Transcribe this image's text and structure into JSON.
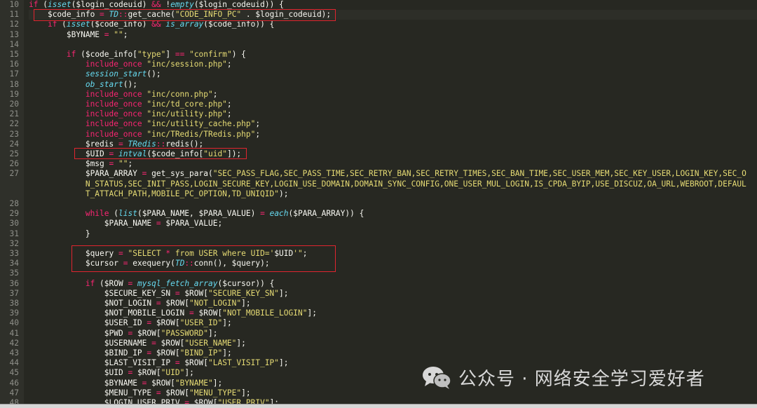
{
  "editor": {
    "theme_colors": {
      "background": "#272822",
      "text": "#f8f8f2",
      "keyword": "#f92672",
      "function": "#66d9ef",
      "string": "#e6db74",
      "highlight": "#e0252f"
    },
    "lines": [
      {
        "n": "10",
        "indent": 0,
        "tokens": [
          [
            "kw",
            "if"
          ],
          [
            "va",
            " ("
          ],
          [
            "fn",
            "isset"
          ],
          [
            "va",
            "($login_codeuid) "
          ],
          [
            "op",
            "&&"
          ],
          [
            "va",
            " !"
          ],
          [
            "fn",
            "empty"
          ],
          [
            "va",
            "($login_codeuid)) {"
          ]
        ]
      },
      {
        "n": "11",
        "indent": 4,
        "tokens": [
          [
            "va",
            "$code_info "
          ],
          [
            "op",
            "="
          ],
          [
            "va",
            " "
          ],
          [
            "cl",
            "TD"
          ],
          [
            "op",
            "::"
          ],
          [
            "va",
            "get_cache("
          ],
          [
            "st",
            "\"CODE_INFO_PC\""
          ],
          [
            "va",
            " . $login_codeuid);"
          ]
        ]
      },
      {
        "n": "12",
        "indent": 4,
        "tokens": [
          [
            "kw",
            "if"
          ],
          [
            "va",
            " ("
          ],
          [
            "fn",
            "isset"
          ],
          [
            "va",
            "($code_info) "
          ],
          [
            "op",
            "&&"
          ],
          [
            "va",
            " "
          ],
          [
            "fn",
            "is_array"
          ],
          [
            "va",
            "($code_info)) {"
          ]
        ]
      },
      {
        "n": "13",
        "indent": 8,
        "tokens": [
          [
            "va",
            "$BYNAME "
          ],
          [
            "op",
            "="
          ],
          [
            "va",
            " "
          ],
          [
            "st",
            "\"\""
          ],
          [
            "va",
            ";"
          ]
        ]
      },
      {
        "n": "14",
        "indent": 0,
        "tokens": []
      },
      {
        "n": "15",
        "indent": 8,
        "tokens": [
          [
            "kw",
            "if"
          ],
          [
            "va",
            " ($code_info["
          ],
          [
            "st",
            "\"type\""
          ],
          [
            "va",
            "] "
          ],
          [
            "op",
            "=="
          ],
          [
            "va",
            " "
          ],
          [
            "st",
            "\"confirm\""
          ],
          [
            "va",
            ") {"
          ]
        ]
      },
      {
        "n": "16",
        "indent": 12,
        "tokens": [
          [
            "kw",
            "include_once"
          ],
          [
            "va",
            " "
          ],
          [
            "st",
            "\"inc/session.php\""
          ],
          [
            "va",
            ";"
          ]
        ]
      },
      {
        "n": "17",
        "indent": 12,
        "tokens": [
          [
            "fn",
            "session_start"
          ],
          [
            "va",
            "();"
          ]
        ]
      },
      {
        "n": "18",
        "indent": 12,
        "tokens": [
          [
            "fn",
            "ob_start"
          ],
          [
            "va",
            "();"
          ]
        ]
      },
      {
        "n": "19",
        "indent": 12,
        "tokens": [
          [
            "kw",
            "include_once"
          ],
          [
            "va",
            " "
          ],
          [
            "st",
            "\"inc/conn.php\""
          ],
          [
            "va",
            ";"
          ]
        ]
      },
      {
        "n": "20",
        "indent": 12,
        "tokens": [
          [
            "kw",
            "include_once"
          ],
          [
            "va",
            " "
          ],
          [
            "st",
            "\"inc/td_core.php\""
          ],
          [
            "va",
            ";"
          ]
        ]
      },
      {
        "n": "21",
        "indent": 12,
        "tokens": [
          [
            "kw",
            "include_once"
          ],
          [
            "va",
            " "
          ],
          [
            "st",
            "\"inc/utility.php\""
          ],
          [
            "va",
            ";"
          ]
        ]
      },
      {
        "n": "22",
        "indent": 12,
        "tokens": [
          [
            "kw",
            "include_once"
          ],
          [
            "va",
            " "
          ],
          [
            "st",
            "\"inc/utility_cache.php\""
          ],
          [
            "va",
            ";"
          ]
        ]
      },
      {
        "n": "23",
        "indent": 12,
        "tokens": [
          [
            "kw",
            "include_once"
          ],
          [
            "va",
            " "
          ],
          [
            "st",
            "\"inc/TRedis/TRedis.php\""
          ],
          [
            "va",
            ";"
          ]
        ]
      },
      {
        "n": "24",
        "indent": 12,
        "tokens": [
          [
            "va",
            "$redis "
          ],
          [
            "op",
            "="
          ],
          [
            "va",
            " "
          ],
          [
            "cl",
            "TRedis"
          ],
          [
            "op",
            "::"
          ],
          [
            "va",
            "redis();"
          ]
        ]
      },
      {
        "n": "25",
        "indent": 12,
        "tokens": [
          [
            "va",
            "$UID "
          ],
          [
            "op",
            "="
          ],
          [
            "va",
            " "
          ],
          [
            "fn",
            "intval"
          ],
          [
            "va",
            "($code_info["
          ],
          [
            "st",
            "\"uid\""
          ],
          [
            "va",
            "]);"
          ]
        ]
      },
      {
        "n": "26",
        "indent": 12,
        "tokens": [
          [
            "va",
            "$msg "
          ],
          [
            "op",
            "="
          ],
          [
            "va",
            " "
          ],
          [
            "st",
            "\"\""
          ],
          [
            "va",
            ";"
          ]
        ]
      },
      {
        "n": "27",
        "indent": 12,
        "tokens": [
          [
            "va",
            "$PARA_ARRAY "
          ],
          [
            "op",
            "="
          ],
          [
            "va",
            " get_sys_para("
          ],
          [
            "st",
            "\"SEC_PASS_FLAG,SEC_PASS_TIME,SEC_RETRY_BAN,SEC_RETRY_TIMES,SEC_BAN_TIME,SEC_USER_MEM,SEC_KEY_USER,LOGIN_KEY,SEC_O"
          ]
        ]
      },
      {
        "n": "",
        "indent": 12,
        "tokens": [
          [
            "st",
            "N_STATUS,SEC_INIT_PASS,LOGIN_SECURE_KEY,LOGIN_USE_DOMAIN,DOMAIN_SYNC_CONFIG,ONE_USER_MUL_LOGIN,IS_CPDA_BYIP,USE_DISCUZ,OA_URL,WEBROOT,DEFAUL"
          ]
        ]
      },
      {
        "n": "",
        "indent": 12,
        "tokens": [
          [
            "st",
            "T_ATTACH_PATH,MOBILE_PC_OPTION,TD_UNIQID\""
          ],
          [
            "va",
            ");"
          ]
        ]
      },
      {
        "n": "28",
        "indent": 0,
        "tokens": []
      },
      {
        "n": "29",
        "indent": 12,
        "tokens": [
          [
            "kw",
            "while"
          ],
          [
            "va",
            " ("
          ],
          [
            "fn",
            "list"
          ],
          [
            "va",
            "($PARA_NAME, $PARA_VALUE) "
          ],
          [
            "op",
            "="
          ],
          [
            "va",
            " "
          ],
          [
            "fn",
            "each"
          ],
          [
            "va",
            "($PARA_ARRAY)) {"
          ]
        ]
      },
      {
        "n": "30",
        "indent": 16,
        "tokens": [
          [
            "va",
            "$PARA_NAME "
          ],
          [
            "op",
            "="
          ],
          [
            "va",
            " $PARA_VALUE;"
          ]
        ]
      },
      {
        "n": "31",
        "indent": 12,
        "tokens": [
          [
            "va",
            "}"
          ]
        ]
      },
      {
        "n": "32",
        "indent": 0,
        "tokens": []
      },
      {
        "n": "33",
        "indent": 12,
        "tokens": [
          [
            "va",
            "$query "
          ],
          [
            "op",
            "="
          ],
          [
            "va",
            " "
          ],
          [
            "st",
            "\"SELECT "
          ],
          [
            "op",
            "*"
          ],
          [
            "st",
            " from USER where UID='"
          ],
          [
            "va",
            "$UID"
          ],
          [
            "st",
            "'\""
          ],
          [
            "va",
            ";"
          ]
        ]
      },
      {
        "n": "34",
        "indent": 12,
        "tokens": [
          [
            "va",
            "$cursor "
          ],
          [
            "op",
            "="
          ],
          [
            "va",
            " exequery("
          ],
          [
            "cl",
            "TD"
          ],
          [
            "op",
            "::"
          ],
          [
            "va",
            "conn(), $query);"
          ]
        ]
      },
      {
        "n": "35",
        "indent": 0,
        "tokens": []
      },
      {
        "n": "36",
        "indent": 12,
        "tokens": [
          [
            "kw",
            "if"
          ],
          [
            "va",
            " ($ROW "
          ],
          [
            "op",
            "="
          ],
          [
            "va",
            " "
          ],
          [
            "fn",
            "mysql_fetch_array"
          ],
          [
            "va",
            "($cursor)) {"
          ]
        ]
      },
      {
        "n": "37",
        "indent": 16,
        "tokens": [
          [
            "va",
            "$SECURE_KEY_SN "
          ],
          [
            "op",
            "="
          ],
          [
            "va",
            " $ROW["
          ],
          [
            "st",
            "\"SECURE_KEY_SN\""
          ],
          [
            "va",
            "];"
          ]
        ]
      },
      {
        "n": "38",
        "indent": 16,
        "tokens": [
          [
            "va",
            "$NOT_LOGIN "
          ],
          [
            "op",
            "="
          ],
          [
            "va",
            " $ROW["
          ],
          [
            "st",
            "\"NOT_LOGIN\""
          ],
          [
            "va",
            "];"
          ]
        ]
      },
      {
        "n": "39",
        "indent": 16,
        "tokens": [
          [
            "va",
            "$NOT_MOBILE_LOGIN "
          ],
          [
            "op",
            "="
          ],
          [
            "va",
            " $ROW["
          ],
          [
            "st",
            "\"NOT_MOBILE_LOGIN\""
          ],
          [
            "va",
            "];"
          ]
        ]
      },
      {
        "n": "40",
        "indent": 16,
        "tokens": [
          [
            "va",
            "$USER_ID "
          ],
          [
            "op",
            "="
          ],
          [
            "va",
            " $ROW["
          ],
          [
            "st",
            "\"USER_ID\""
          ],
          [
            "va",
            "];"
          ]
        ]
      },
      {
        "n": "41",
        "indent": 16,
        "tokens": [
          [
            "va",
            "$PWD "
          ],
          [
            "op",
            "="
          ],
          [
            "va",
            " $ROW["
          ],
          [
            "st",
            "\"PASSWORD\""
          ],
          [
            "va",
            "];"
          ]
        ]
      },
      {
        "n": "42",
        "indent": 16,
        "tokens": [
          [
            "va",
            "$USERNAME "
          ],
          [
            "op",
            "="
          ],
          [
            "va",
            " $ROW["
          ],
          [
            "st",
            "\"USER_NAME\""
          ],
          [
            "va",
            "];"
          ]
        ]
      },
      {
        "n": "43",
        "indent": 16,
        "tokens": [
          [
            "va",
            "$BIND_IP "
          ],
          [
            "op",
            "="
          ],
          [
            "va",
            " $ROW["
          ],
          [
            "st",
            "\"BIND_IP\""
          ],
          [
            "va",
            "];"
          ]
        ]
      },
      {
        "n": "44",
        "indent": 16,
        "tokens": [
          [
            "va",
            "$LAST_VISIT_IP "
          ],
          [
            "op",
            "="
          ],
          [
            "va",
            " $ROW["
          ],
          [
            "st",
            "\"LAST_VISIT_IP\""
          ],
          [
            "va",
            "];"
          ]
        ]
      },
      {
        "n": "45",
        "indent": 16,
        "tokens": [
          [
            "va",
            "$UID "
          ],
          [
            "op",
            "="
          ],
          [
            "va",
            " $ROW["
          ],
          [
            "st",
            "\"UID\""
          ],
          [
            "va",
            "];"
          ]
        ]
      },
      {
        "n": "46",
        "indent": 16,
        "tokens": [
          [
            "va",
            "$BYNAME "
          ],
          [
            "op",
            "="
          ],
          [
            "va",
            " $ROW["
          ],
          [
            "st",
            "\"BYNAME\""
          ],
          [
            "va",
            "];"
          ]
        ]
      },
      {
        "n": "47",
        "indent": 16,
        "tokens": [
          [
            "va",
            "$MENU_TYPE "
          ],
          [
            "op",
            "="
          ],
          [
            "va",
            " $ROW["
          ],
          [
            "st",
            "\"MENU_TYPE\""
          ],
          [
            "va",
            "];"
          ]
        ]
      },
      {
        "n": "48",
        "indent": 16,
        "tokens": [
          [
            "va",
            "$LOGIN_USER_PRIV "
          ],
          [
            "op",
            "="
          ],
          [
            "va",
            " $ROW["
          ],
          [
            "st",
            "\"USER_PRIV\""
          ],
          [
            "va",
            "];"
          ]
        ]
      }
    ]
  },
  "watermark": {
    "text": "公众号 · 网络安全学习爱好者",
    "icon": "wechat-icon"
  }
}
